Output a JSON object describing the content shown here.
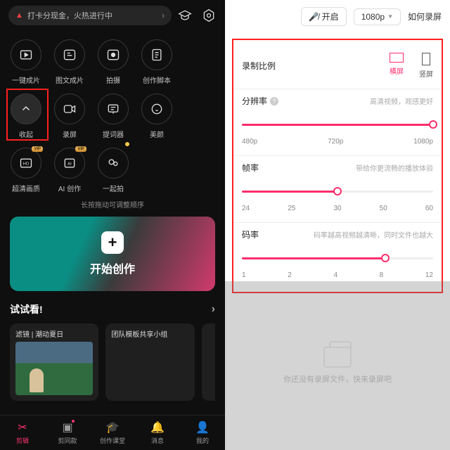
{
  "left": {
    "promo": "打卡分现金，火热进行中",
    "grid": [
      {
        "label": "一键成片"
      },
      {
        "label": "图文成片"
      },
      {
        "label": "拍摄"
      },
      {
        "label": "创作脚本"
      },
      {
        "label": "收起"
      },
      {
        "label": "录屏"
      },
      {
        "label": "提词器"
      },
      {
        "label": "美颜"
      },
      {
        "label": "超清画质",
        "vip": "VIP"
      },
      {
        "label": "AI 创作",
        "vip": "VIP"
      },
      {
        "label": "一起拍"
      }
    ],
    "hint": "长按拖动可调整顺序",
    "create": "开始创作",
    "try": "试试看!",
    "cards": [
      {
        "title": "滤镜 | 潮动夏日"
      },
      {
        "title": "团队模板共享小组"
      }
    ],
    "nav": [
      {
        "label": "剪辑"
      },
      {
        "label": "剪同款"
      },
      {
        "label": "创作课堂"
      },
      {
        "label": "消息"
      },
      {
        "label": "我的"
      }
    ]
  },
  "right": {
    "open_label": "开启",
    "res_chip": "1080p",
    "howto": "如何录屏",
    "ratio_label": "录制比例",
    "orient_h": "横屏",
    "orient_v": "竖屏",
    "resolution": {
      "label": "分辨率",
      "sub": "高清视频，观感更好",
      "ticks": [
        "480p",
        "720p",
        "1080p"
      ]
    },
    "fps": {
      "label": "帧率",
      "sub": "带给你更流畅的播放体验",
      "ticks": [
        "24",
        "25",
        "30",
        "50",
        "60"
      ]
    },
    "bitrate": {
      "label": "码率",
      "sub": "码率越高视频越清晰，同时文件也越大",
      "ticks": [
        "1",
        "2",
        "4",
        "8",
        "12"
      ]
    },
    "empty": "你还没有录屏文件，快来录屏吧"
  }
}
